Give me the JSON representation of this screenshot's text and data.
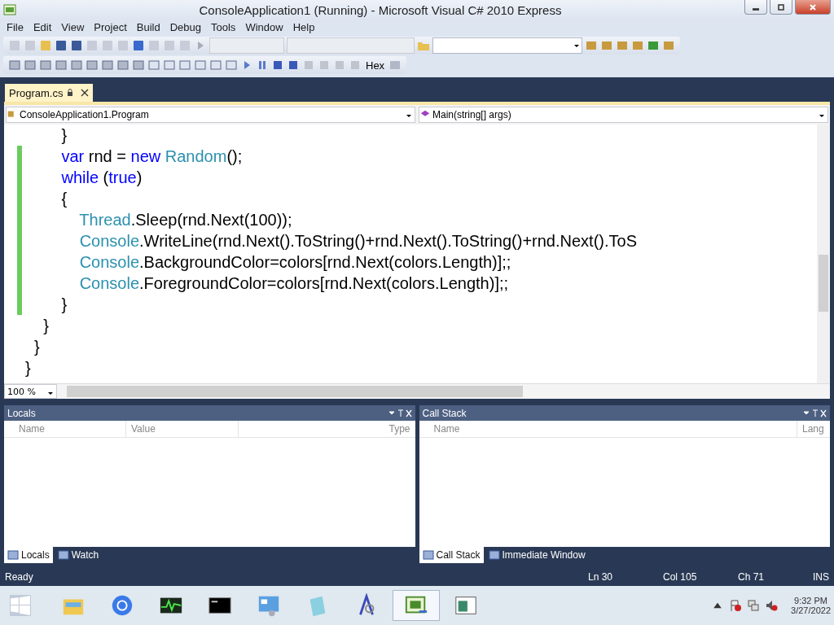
{
  "window": {
    "title": "ConsoleApplication1 (Running) - Microsoft Visual C# 2010 Express"
  },
  "menu": [
    "File",
    "Edit",
    "View",
    "Project",
    "Build",
    "Debug",
    "Tools",
    "Window",
    "Help"
  ],
  "toolbar": {
    "hex_button": "Hex"
  },
  "document_tabs": [
    {
      "label": "Program.cs",
      "selected": true
    }
  ],
  "navigation": {
    "class_combo": "ConsoleApplication1.Program",
    "member_combo": "Main(string[] args)"
  },
  "code": [
    {
      "tokens": [
        {
          "text": "        }",
          "kind": "plain"
        }
      ]
    },
    {
      "tokens": [
        {
          "text": "        var",
          "kind": "keyword"
        },
        {
          "text": " rnd = ",
          "kind": "plain"
        },
        {
          "text": "new ",
          "kind": "keyword"
        },
        {
          "text": "Random",
          "kind": "type"
        },
        {
          "text": "();",
          "kind": "plain"
        }
      ]
    },
    {
      "tokens": [
        {
          "text": "        while",
          "kind": "keyword"
        },
        {
          "text": " (",
          "kind": "plain"
        },
        {
          "text": "true",
          "kind": "keyword"
        },
        {
          "text": ")",
          "kind": "plain"
        }
      ]
    },
    {
      "tokens": [
        {
          "text": "        {",
          "kind": "plain"
        }
      ]
    },
    {
      "tokens": [
        {
          "text": "            Thread",
          "kind": "type"
        },
        {
          "text": ".Sleep(rnd.Next(100));",
          "kind": "plain"
        }
      ]
    },
    {
      "tokens": [
        {
          "text": "            Console",
          "kind": "type"
        },
        {
          "text": ".WriteLine(rnd.Next().ToString()+rnd.Next().ToString()+rnd.Next().ToS",
          "kind": "plain"
        }
      ]
    },
    {
      "tokens": [
        {
          "text": "            Console",
          "kind": "type"
        },
        {
          "text": ".BackgroundColor=colors[rnd.Next(colors.Length)];;",
          "kind": "plain"
        }
      ]
    },
    {
      "tokens": [
        {
          "text": "            Console",
          "kind": "type"
        },
        {
          "text": ".ForegroundColor=colors[rnd.Next(colors.Length)];;",
          "kind": "plain"
        }
      ]
    },
    {
      "tokens": [
        {
          "text": "        }",
          "kind": "plain"
        }
      ]
    },
    {
      "tokens": [
        {
          "text": "    }",
          "kind": "plain"
        }
      ]
    },
    {
      "tokens": [
        {
          "text": "  }",
          "kind": "plain"
        }
      ]
    },
    {
      "tokens": [
        {
          "text": "}",
          "kind": "plain"
        }
      ]
    }
  ],
  "zoom_combo": "100 %",
  "panels": [
    {
      "title": "Locals",
      "columns": [
        "Name",
        "Value",
        "Type"
      ],
      "tabs": [
        {
          "label": "Locals",
          "selected": true
        },
        {
          "label": "Watch",
          "selected": false
        }
      ]
    },
    {
      "title": "Call Stack",
      "columns": [
        "Name",
        "Lang"
      ],
      "tabs": [
        {
          "label": "Call Stack",
          "selected": true
        },
        {
          "label": "Immediate Window",
          "selected": false
        }
      ]
    }
  ],
  "status_bar": {
    "message": "Ready",
    "line": "Ln 30",
    "column": "Col 105",
    "char": "Ch 71",
    "mode": "INS"
  },
  "taskbar": {
    "time": "9:32 PM",
    "date": "3/27/2022"
  }
}
